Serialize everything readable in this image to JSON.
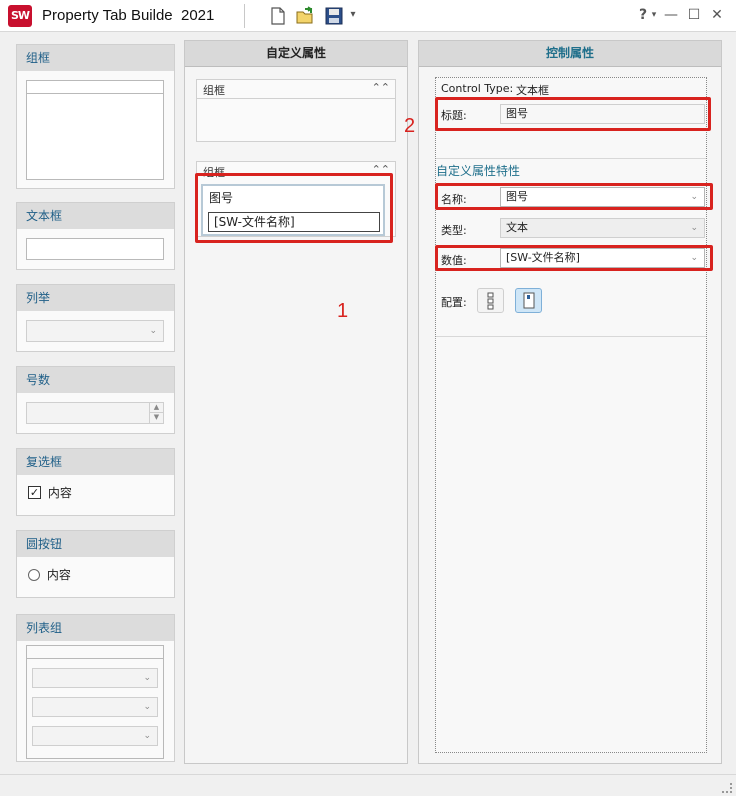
{
  "window": {
    "logo_text": "SW",
    "title": "Property Tab Builde",
    "year": "2021",
    "help_label": "?",
    "dropdown_arrow": "▾",
    "minimize": "—",
    "maximize": "☐",
    "close": "✕"
  },
  "toolbar": {
    "icons": [
      "new-file-icon",
      "open-folder-icon",
      "save-disk-icon",
      "dropdown-arrow-icon"
    ]
  },
  "toolbox": {
    "groupbox": {
      "label": "组框"
    },
    "textbox": {
      "label": "文本框"
    },
    "list": {
      "label": "列举"
    },
    "number": {
      "label": "号数"
    },
    "checkbox": {
      "label": "复选框",
      "item_label": "内容",
      "checked": true
    },
    "radio": {
      "label": "圆按钮",
      "item_label": "内容"
    },
    "listgroup": {
      "label": "列表组"
    }
  },
  "center": {
    "title": "自定义属性",
    "group1": {
      "label": "组框",
      "collapse": "«"
    },
    "group2": {
      "label": "组框",
      "collapse": "«"
    },
    "field_label": "图号",
    "field_value": "[SW-文件名称]",
    "marker": "1"
  },
  "right": {
    "title": "控制属性",
    "control_type_label": "Control Type:",
    "control_type_value": "文本框",
    "caption_label": "标题:",
    "caption_value": "图号",
    "marker": "2",
    "section_title": "自定义属性特性",
    "name_label": "名称:",
    "name_value": "图号",
    "type_label": "类型:",
    "type_value": "文本",
    "value_label": "数值:",
    "value_value": "[SW-文件名称]",
    "config_label": "配置:"
  },
  "colors": {
    "accent_red": "#d8231f",
    "header_teal": "#1f6f8b",
    "brand_red": "#c8102e"
  }
}
